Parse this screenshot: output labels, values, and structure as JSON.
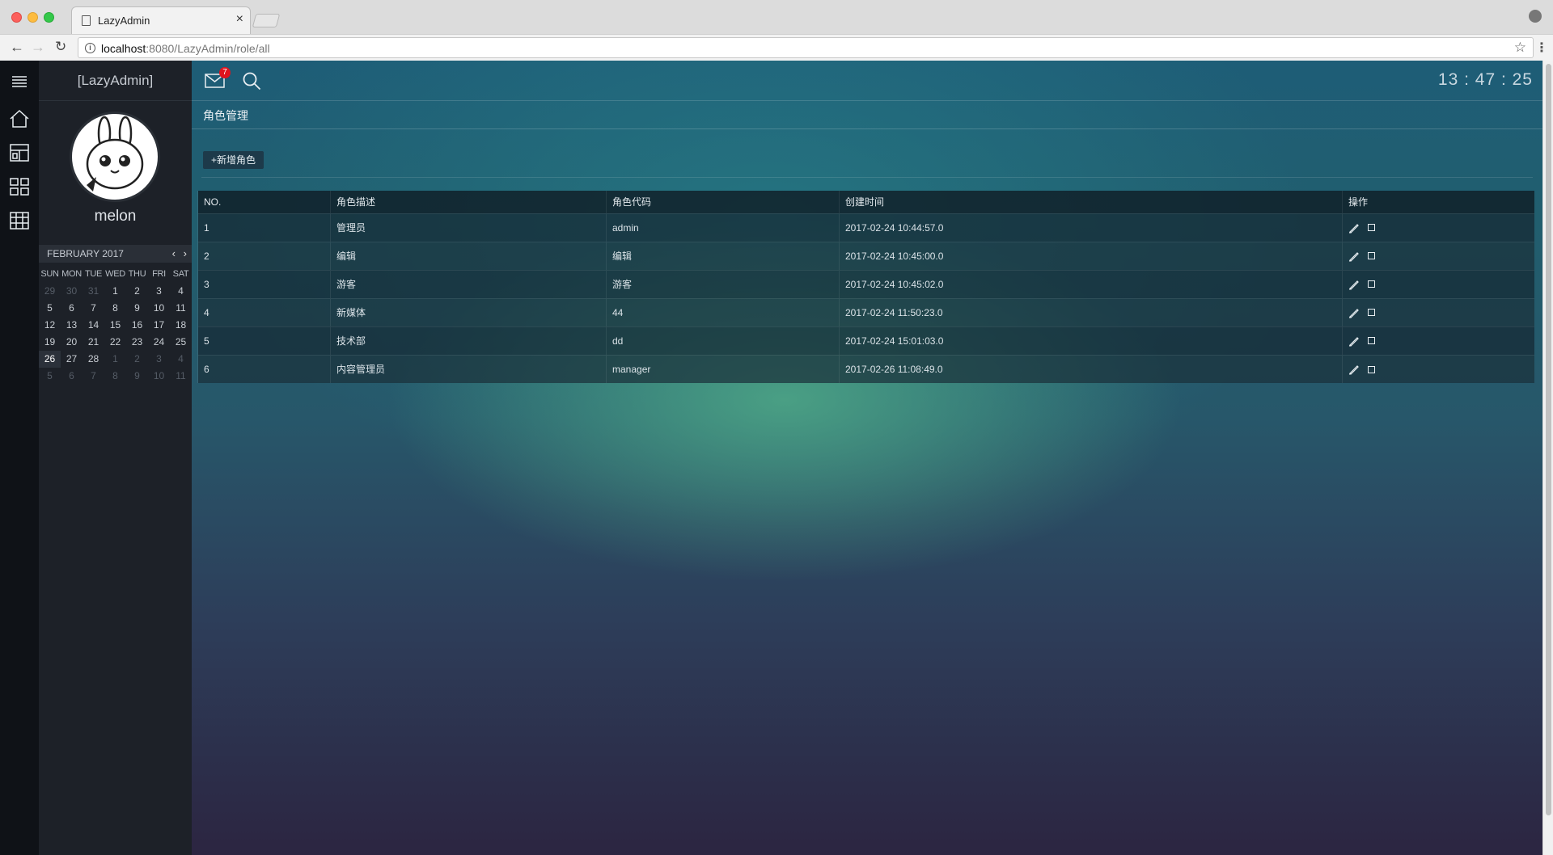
{
  "browser": {
    "tab_title": "LazyAdmin",
    "tab_close": "×",
    "url_host": "localhost",
    "url_path": ":8080/LazyAdmin/role/all"
  },
  "sidebar": {
    "title": "[LazyAdmin]",
    "username": "melon",
    "nav_icons": [
      "home-icon",
      "dashboard-icon",
      "grid-icon",
      "table-icon"
    ]
  },
  "calendar": {
    "month_label": "FEBRUARY 2017",
    "prev": "‹",
    "next": "›",
    "weekdays": [
      "SUN",
      "MON",
      "TUE",
      "WED",
      "THU",
      "FRI",
      "SAT"
    ],
    "weeks": [
      [
        "29",
        "30",
        "31",
        "1",
        "2",
        "3",
        "4"
      ],
      [
        "5",
        "6",
        "7",
        "8",
        "9",
        "10",
        "11"
      ],
      [
        "12",
        "13",
        "14",
        "15",
        "16",
        "17",
        "18"
      ],
      [
        "19",
        "20",
        "21",
        "22",
        "23",
        "24",
        "25"
      ],
      [
        "26",
        "27",
        "28",
        "1",
        "2",
        "3",
        "4"
      ],
      [
        "5",
        "6",
        "7",
        "8",
        "9",
        "10",
        "11"
      ]
    ],
    "today": "26"
  },
  "header": {
    "mail_count": "7",
    "clock": "13 : 47 : 25"
  },
  "page": {
    "title": "角色管理",
    "add_button": "+新增角色"
  },
  "table": {
    "columns": [
      "NO.",
      "角色描述",
      "角色代码",
      "创建时间",
      "操作"
    ],
    "rows": [
      {
        "no": "1",
        "desc": "管理员",
        "code": "admin",
        "created": "2017-02-24 10:44:57.0"
      },
      {
        "no": "2",
        "desc": "编辑",
        "code": "编辑",
        "created": "2017-02-24 10:45:00.0"
      },
      {
        "no": "3",
        "desc": "游客",
        "code": "游客",
        "created": "2017-02-24 10:45:02.0"
      },
      {
        "no": "4",
        "desc": "新媒体",
        "code": "44",
        "created": "2017-02-24 11:50:23.0"
      },
      {
        "no": "5",
        "desc": "技术部",
        "code": "dd",
        "created": "2017-02-24 15:01:03.0"
      },
      {
        "no": "6",
        "desc": "内容管理员",
        "code": "manager",
        "created": "2017-02-26 11:08:49.0"
      }
    ]
  }
}
